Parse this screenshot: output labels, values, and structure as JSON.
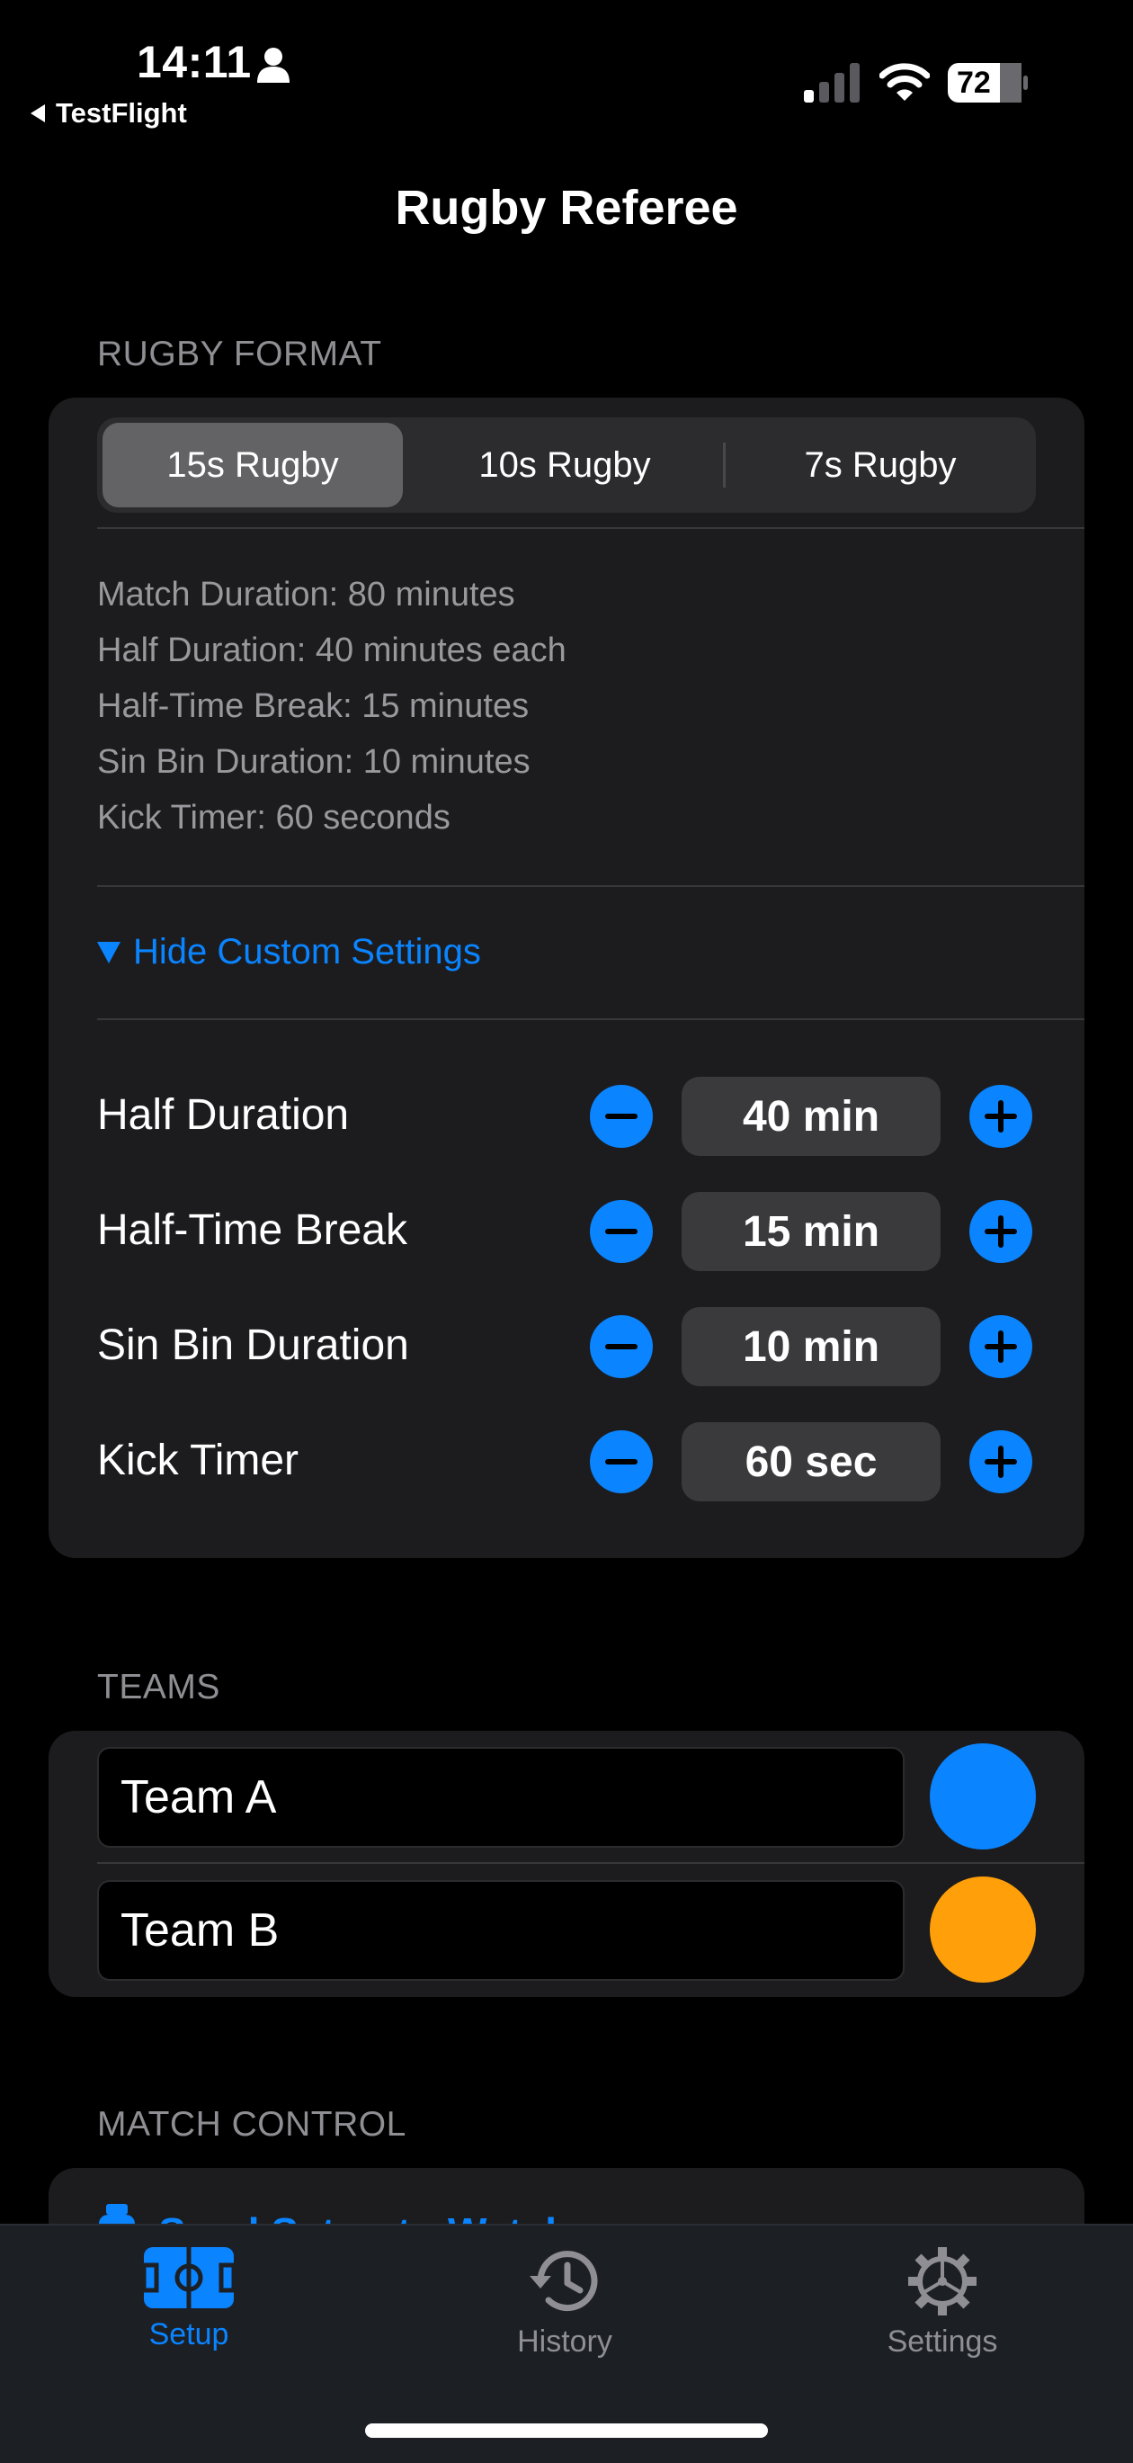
{
  "status_bar": {
    "time": "14:11",
    "back_label": "TestFlight",
    "battery": "72"
  },
  "nav": {
    "title": "Rugby Referee"
  },
  "format_section": {
    "header": "RUGBY FORMAT",
    "segments": [
      "15s Rugby",
      "10s Rugby",
      "7s Rugby"
    ],
    "selected_segment": "15s Rugby",
    "info_lines": [
      "Match Duration: 80 minutes",
      "Half Duration: 40 minutes each",
      "Half-Time Break: 15 minutes",
      "Sin Bin Duration: 10 minutes",
      "Kick Timer: 60 seconds"
    ],
    "toggle_label": "Hide Custom Settings",
    "settings": [
      {
        "label": "Half Duration",
        "value": "40 min"
      },
      {
        "label": "Half-Time Break",
        "value": "15 min"
      },
      {
        "label": "Sin Bin Duration",
        "value": "10 min"
      },
      {
        "label": "Kick Timer",
        "value": "60 sec"
      }
    ]
  },
  "teams_section": {
    "header": "TEAMS",
    "teams": [
      {
        "name": "Team A",
        "color": "#0a84ff"
      },
      {
        "name": "Team B",
        "color": "#ff9f0a"
      }
    ]
  },
  "match_section": {
    "header": "MATCH CONTROL",
    "row_label": "Send Setup to Watch"
  },
  "tabbar": {
    "tabs": [
      {
        "label": "Setup",
        "icon": "pitch-icon",
        "active": true
      },
      {
        "label": "History",
        "icon": "history-icon",
        "active": false
      },
      {
        "label": "Settings",
        "icon": "gear-icon",
        "active": false
      }
    ]
  },
  "colors": {
    "accent": "#0a84ff",
    "inactive_tab": "#8e8e93",
    "card": "#1c1c1e"
  }
}
